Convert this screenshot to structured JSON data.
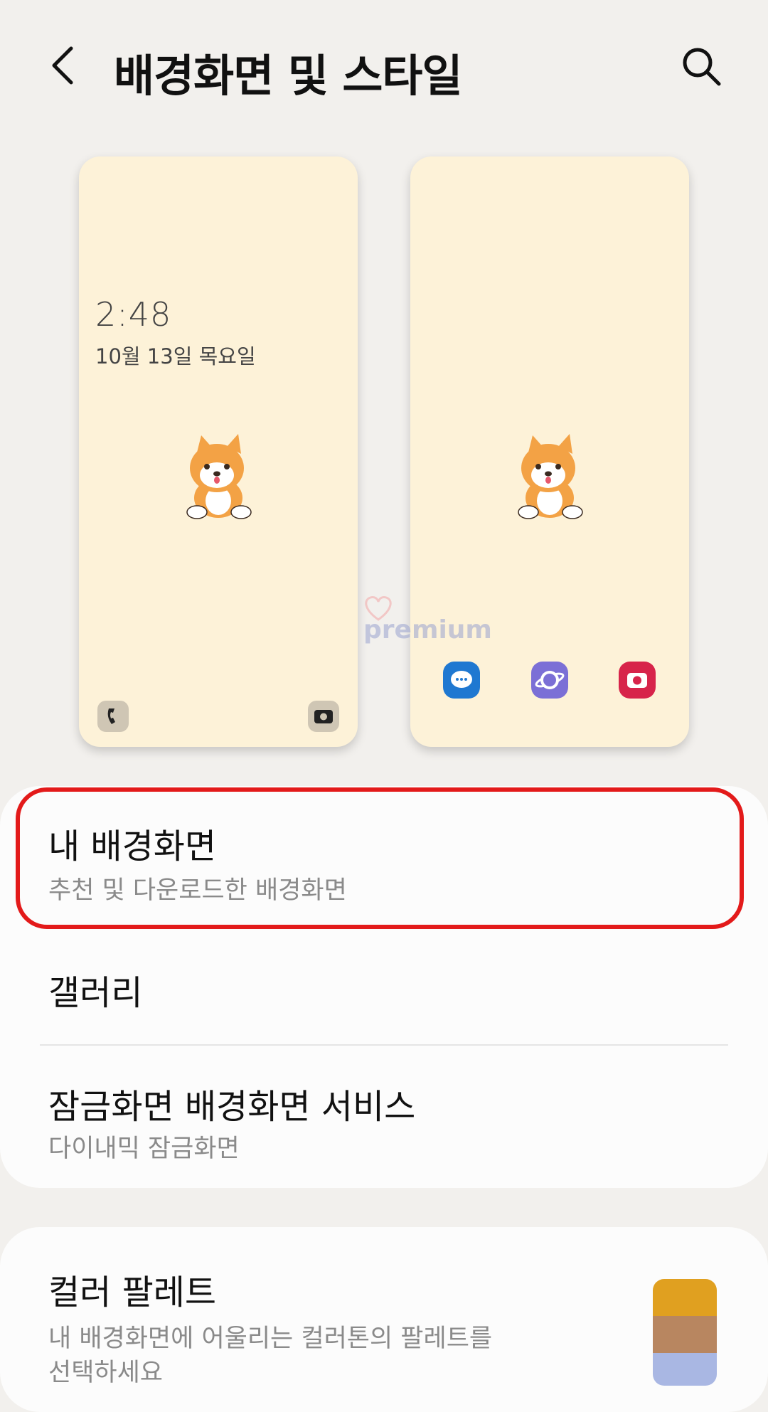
{
  "header": {
    "title": "배경화면 및 스타일"
  },
  "lock_preview": {
    "time": "2:48",
    "date": "10월 13일 목요일"
  },
  "watermark": {
    "text": "premium"
  },
  "menu": {
    "my_wallpaper": {
      "title": "내 배경화면",
      "subtitle": "추천 및 다운로드한 배경화면"
    },
    "gallery": {
      "title": "갤러리"
    },
    "lock_service": {
      "title": "잠금화면 배경화면 서비스",
      "subtitle": "다이내믹 잠금화면"
    }
  },
  "palette": {
    "title": "컬러 팔레트",
    "subtitle": "내 배경화면에 어울리는 컬러톤의 팔레트를",
    "subtitle2": "선택하세요",
    "swatch_colors": [
      "#e0a020",
      "#b88660",
      "#a9b7e3"
    ]
  },
  "colors": {
    "highlight": "#e31a1a",
    "preview_bg": "#fdf2d8"
  }
}
